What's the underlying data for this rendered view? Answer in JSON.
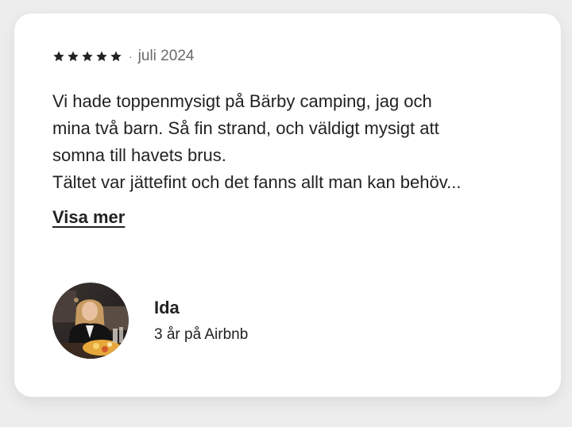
{
  "review": {
    "rating": 5,
    "separator": "·",
    "date": "juli 2024",
    "text": "Vi hade toppenmysigt på Bärby camping, jag och\nmina två barn. Så fin strand, och väldigt mysigt att\nsomna till havets brus.\nTältet var jättefint och det fanns allt man kan behöv...",
    "show_more_label": "Visa mer"
  },
  "reviewer": {
    "name": "Ida",
    "tenure": "3 år på Airbnb",
    "avatar_icon": "user-photo"
  },
  "colors": {
    "background": "#ededed",
    "card": "#ffffff",
    "text": "#222222",
    "muted": "#6a6a6a"
  }
}
